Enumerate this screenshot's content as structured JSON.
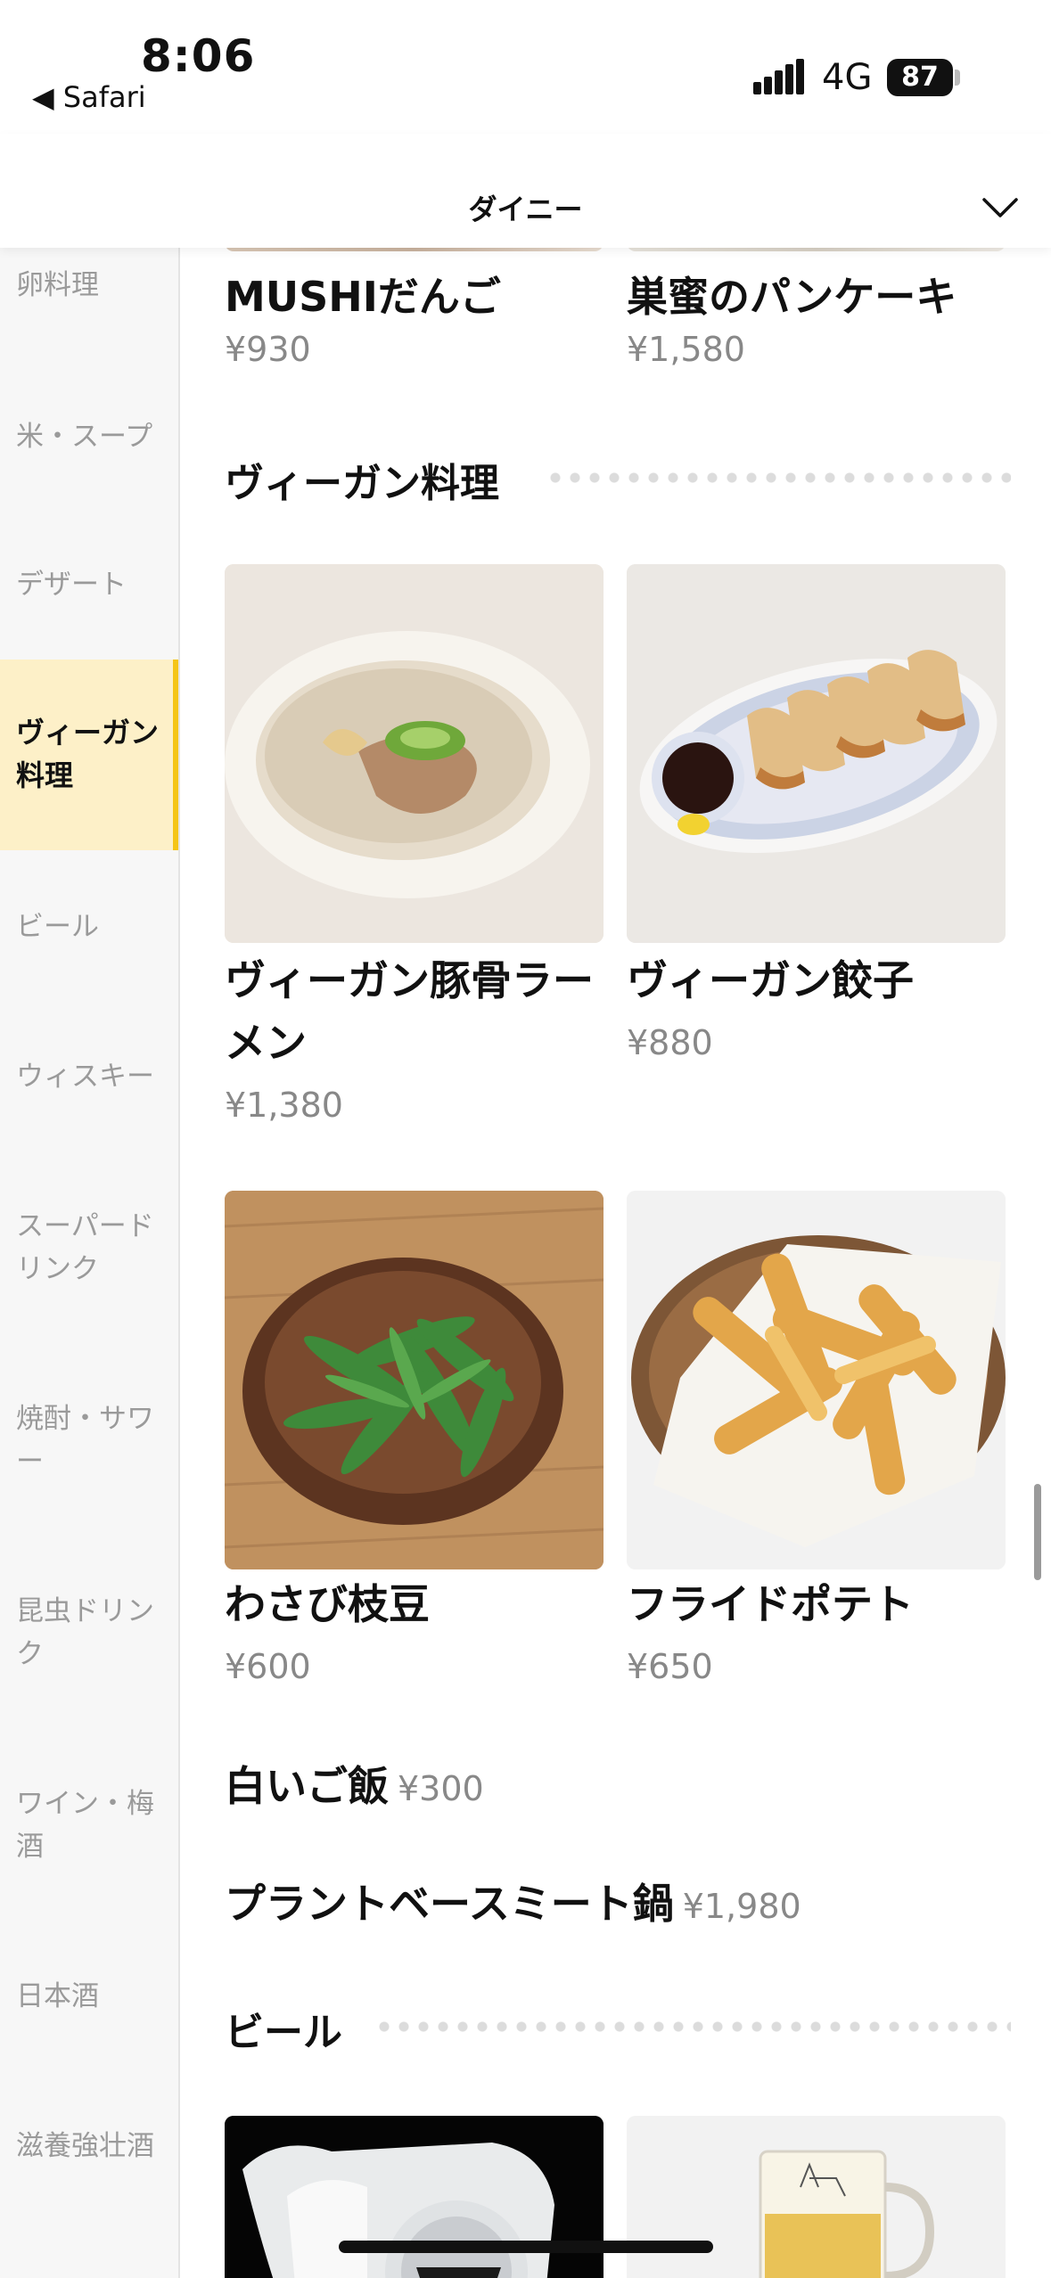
{
  "status_bar": {
    "time": "8:06",
    "back_label": "◀ Safari",
    "network": "4G",
    "battery": "87"
  },
  "header": {
    "title": "ダイニー",
    "chevron_icon": "chevron-down-icon"
  },
  "sidebar": {
    "items": [
      {
        "label": "卵料理"
      },
      {
        "label": "米・スープ"
      },
      {
        "label": "デザート"
      },
      {
        "label": "ヴィーガン料理",
        "active": true
      },
      {
        "label": "ビール"
      },
      {
        "label": "ウィスキー"
      },
      {
        "label": "スーパードリンク"
      },
      {
        "label": "焼酎・サワー"
      },
      {
        "label": "昆虫ドリンク"
      },
      {
        "label": "ワイン・梅酒"
      },
      {
        "label": "日本酒"
      },
      {
        "label": "滋養強壮酒"
      }
    ]
  },
  "main": {
    "top_items": [
      {
        "name": "MUSHIだんご",
        "price": "¥930"
      },
      {
        "name": "巣蜜のパンケーキ",
        "price": "¥1,580"
      }
    ],
    "sections": [
      {
        "title": "ヴィーガン料理",
        "items": [
          {
            "name": "ヴィーガン豚骨ラーメン",
            "price": "¥1,380",
            "image": "ramen-photo"
          },
          {
            "name": "ヴィーガン餃子",
            "price": "¥880",
            "image": "gyoza-photo"
          },
          {
            "name": "わさび枝豆",
            "price": "¥600",
            "image": "edamame-photo"
          },
          {
            "name": "フライドポテト",
            "price": "¥650",
            "image": "fries-photo"
          }
        ],
        "text_items": [
          {
            "name": "白いご飯",
            "price": "¥300"
          },
          {
            "name": "プラントベースミート鍋",
            "price": "¥1,980"
          }
        ]
      },
      {
        "title": "ビール",
        "items": [
          {
            "image": "beer-jug-photo"
          },
          {
            "image": "beer-glass-photo"
          }
        ]
      }
    ]
  },
  "colors": {
    "accent": "#f5c518",
    "active_bg": "#fdf0c8",
    "muted_text": "#888888"
  }
}
